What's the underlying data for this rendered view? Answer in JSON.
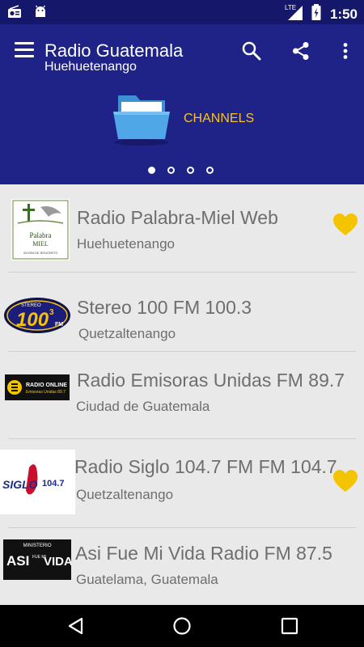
{
  "status_bar": {
    "time": "1:50",
    "network": "LTE",
    "icons": [
      "radio-icon",
      "android-icon",
      "lte-signal-icon",
      "battery-icon"
    ]
  },
  "app_bar": {
    "title": "Radio Guatemala",
    "subtitle": "Huehuetenango",
    "actions": [
      "search-icon",
      "share-icon",
      "more-vert-icon"
    ],
    "header_label": "CHANNELS",
    "page_indicator": {
      "total": 4,
      "active": 0
    }
  },
  "colors": {
    "status_bar": "#15176a",
    "app_bar": "#1f2387",
    "accent": "#f5c22b",
    "list_bg": "#e9e9e9",
    "text": "#6e6e6e"
  },
  "stations": [
    {
      "name": "Radio Palabra-Miel Web",
      "city": "Huehuetenango",
      "favorite": true,
      "logo_text": [
        "Palabra",
        "MIEL",
        "IGLESIA DE JESUCRISTO"
      ]
    },
    {
      "name": "Stereo 100 FM 100.3",
      "city": "Quetzaltenango",
      "favorite": false,
      "logo_text": [
        "STEREO",
        "100",
        "3",
        "FM"
      ]
    },
    {
      "name": "Radio Emisoras Unidas FM 89.7",
      "city": "Ciudad de Guatemala",
      "favorite": false,
      "logo_text": [
        "RADIO ONLINE",
        "Emisoras Unidas 89.7"
      ]
    },
    {
      "name": "Radio Siglo 104.7 FM FM 104.7",
      "city": "Quetzaltenango",
      "favorite": true,
      "logo_text": [
        "SIGLO",
        "104.7"
      ]
    },
    {
      "name": "Asi Fue Mi Vida Radio FM 87.5",
      "city": "Guatelama, Guatemala",
      "favorite": false,
      "logo_text": [
        "MINISTERIO",
        "ASI",
        "FUE MI",
        "VIDA"
      ]
    }
  ],
  "nav_bar": [
    "back-icon",
    "home-icon",
    "recents-icon"
  ]
}
